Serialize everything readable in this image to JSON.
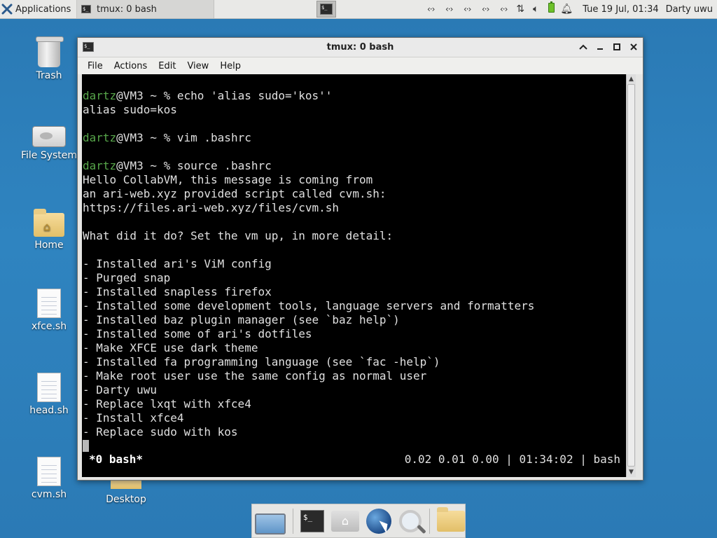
{
  "top_panel": {
    "applications_label": "Applications",
    "task_title": "tmux: 0 bash",
    "clock": "Tue 19 Jul, 01:34",
    "user": "Darty uwu",
    "network_icon_glyph": "‹·›"
  },
  "desktop": {
    "icons": [
      {
        "label": "Trash",
        "icon": "trash-icon"
      },
      {
        "label": "File System",
        "icon": "drive-icon"
      },
      {
        "label": "Home",
        "icon": "home-folder-icon"
      },
      {
        "label": "xfce.sh",
        "icon": "script-file-icon"
      },
      {
        "label": "head.sh",
        "icon": "script-file-icon"
      },
      {
        "label": "cvm.sh",
        "icon": "script-file-icon"
      },
      {
        "label": "Desktop",
        "icon": "folder-icon"
      }
    ]
  },
  "window": {
    "title": "tmux: 0 bash",
    "menu": [
      "File",
      "Actions",
      "Edit",
      "View",
      "Help"
    ]
  },
  "terminal": {
    "prompt_user": "dartz",
    "prompt_rest": "@VM3 ~ % ",
    "lines": [
      {
        "type": "cmd",
        "text": "echo 'alias sudo='kos''"
      },
      {
        "type": "out",
        "text": "alias sudo=kos"
      },
      {
        "type": "blank",
        "text": ""
      },
      {
        "type": "cmd",
        "text": "vim .bashrc"
      },
      {
        "type": "blank",
        "text": ""
      },
      {
        "type": "cmd",
        "text": "source .bashrc"
      },
      {
        "type": "out",
        "text": "Hello CollabVM, this message is coming from"
      },
      {
        "type": "out",
        "text": "an ari-web.xyz provided script called cvm.sh:"
      },
      {
        "type": "out",
        "text": "https://files.ari-web.xyz/files/cvm.sh"
      },
      {
        "type": "blank",
        "text": ""
      },
      {
        "type": "out",
        "text": "What did it do? Set the vm up, in more detail:"
      },
      {
        "type": "blank",
        "text": ""
      },
      {
        "type": "out",
        "text": "- Installed ari's ViM config"
      },
      {
        "type": "out",
        "text": "- Purged snap"
      },
      {
        "type": "out",
        "text": "- Installed snapless firefox"
      },
      {
        "type": "out",
        "text": "- Installed some development tools, language servers and formatters"
      },
      {
        "type": "out",
        "text": "- Installed baz plugin manager (see `baz help`)"
      },
      {
        "type": "out",
        "text": "- Installed some of ari's dotfiles"
      },
      {
        "type": "out",
        "text": "- Make XFCE use dark theme"
      },
      {
        "type": "out",
        "text": "- Installed fa programming language (see `fac -help`)"
      },
      {
        "type": "out",
        "text": "- Make root user use the same config as normal user"
      },
      {
        "type": "out",
        "text": "- Darty uwu"
      },
      {
        "type": "out",
        "text": "- Replace lxqt with xfce4"
      },
      {
        "type": "out",
        "text": "- Install xfce4"
      },
      {
        "type": "out",
        "text": "- Replace sudo with kos"
      },
      {
        "type": "cursor",
        "text": ""
      }
    ],
    "tmux_window": "*0 bash*",
    "tmux_status_right": "0.02 0.01 0.00 | 01:34:02 | bash"
  },
  "dock": {
    "items": [
      "show-desktop-icon",
      "terminal-icon",
      "home-icon",
      "web-browser-icon",
      "app-finder-icon",
      "folder-icon"
    ]
  },
  "colors": {
    "prompt_user": "#57a64a",
    "terminal_bg": "#000000",
    "terminal_fg": "#e0e0e0",
    "desktop_bg": "#2f84c0"
  }
}
